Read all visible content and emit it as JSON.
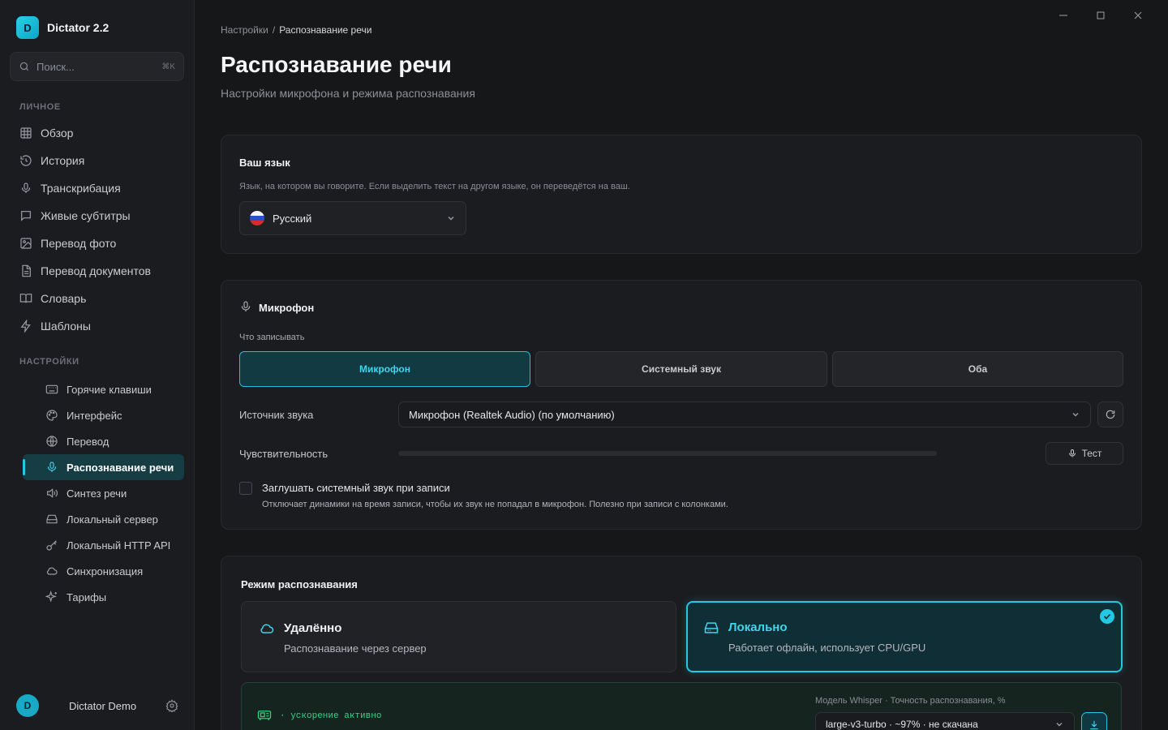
{
  "app": {
    "logo_letter": "D",
    "name": "Dictator 2.2"
  },
  "search": {
    "placeholder": "Поиск...",
    "shortcut": "⌘K"
  },
  "sidebar": {
    "personal_label": "ЛИЧНОЕ",
    "personal_items": [
      {
        "label": "Обзор",
        "icon": "grid-icon"
      },
      {
        "label": "История",
        "icon": "history-icon"
      },
      {
        "label": "Транскрибация",
        "icon": "mic-icon"
      },
      {
        "label": "Живые субтитры",
        "icon": "chat-icon"
      },
      {
        "label": "Перевод фото",
        "icon": "image-icon"
      },
      {
        "label": "Перевод документов",
        "icon": "document-icon"
      },
      {
        "label": "Словарь",
        "icon": "book-icon"
      },
      {
        "label": "Шаблоны",
        "icon": "bolt-icon"
      }
    ],
    "settings_label": "НАСТРОЙКИ",
    "settings_items": [
      {
        "label": "Горячие клавиши",
        "icon": "keyboard-icon"
      },
      {
        "label": "Интерфейс",
        "icon": "palette-icon"
      },
      {
        "label": "Перевод",
        "icon": "globe-icon"
      },
      {
        "label": "Распознавание речи",
        "icon": "mic-icon",
        "active": true
      },
      {
        "label": "Синтез речи",
        "icon": "speaker-icon"
      },
      {
        "label": "Локальный сервер",
        "icon": "server-icon"
      },
      {
        "label": "Локальный HTTP API",
        "icon": "key-icon"
      },
      {
        "label": "Синхронизация",
        "icon": "cloud-icon"
      },
      {
        "label": "Тарифы",
        "icon": "sparkles-icon"
      }
    ]
  },
  "user": {
    "initial": "D",
    "name": "Dictator Demo"
  },
  "breadcrumb": {
    "parent": "Настройки",
    "separator": "/",
    "current": "Распознавание речи"
  },
  "page": {
    "title": "Распознавание речи",
    "subtitle": "Настройки микрофона и режима распознавания"
  },
  "language": {
    "title": "Ваш язык",
    "description": "Язык, на котором вы говорите. Если выделить текст на другом языке, он переведётся на ваш.",
    "selected": "Русский"
  },
  "microphone": {
    "title": "Микрофон",
    "record_label": "Что записывать",
    "record_options": [
      "Микрофон",
      "Системный звук",
      "Оба"
    ],
    "record_selected": 0,
    "source_label": "Источник звука",
    "source_value": "Микрофон (Realtek Audio) (по умолчанию)",
    "sensitivity_label": "Чувствительность",
    "sensitivity_level": 0,
    "test_label": "Тест",
    "mute_title": "Заглушать системный звук при записи",
    "mute_description": "Отключает динамики на время записи, чтобы их звук не попадал в микрофон. Полезно при записи с колонками.",
    "mute_checked": false
  },
  "recognition": {
    "title": "Режим распознавания",
    "modes": [
      {
        "title": "Удалённо",
        "description": "Распознавание через сервер",
        "icon": "cloud-icon",
        "selected": false
      },
      {
        "title": "Локально",
        "description": "Работает офлайн, использует CPU/GPU",
        "icon": "hard-drive-icon",
        "selected": true
      }
    ],
    "accel_status": "· ускорение активно",
    "model_label": "Модель Whisper · Точность распознавания, %",
    "model_value": "large-v3-turbo · ~97% · не скачана"
  },
  "colors": {
    "accent": "#22c9e2",
    "background": "#161719",
    "sidebar": "#1b1c1f",
    "card": "#1b1c1f"
  }
}
